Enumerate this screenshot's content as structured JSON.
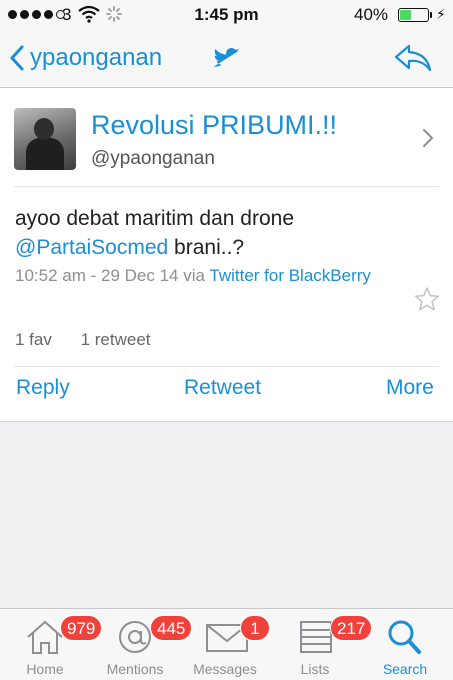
{
  "status_bar": {
    "carrier": "3",
    "time": "1:45 pm",
    "battery_percent": "40%",
    "battery_level": 0.4
  },
  "nav": {
    "back_label": "ypaonganan",
    "center_icon": "twitter-bird-icon",
    "right_icon": "reply-icon"
  },
  "tweet": {
    "display_name": "Revolusi PRIBUMI.!!",
    "handle": "@ypaonganan",
    "text_before": "ayoo debat maritim dan drone",
    "mention": "@PartaiSocmed",
    "text_after": " brani..?",
    "timestamp": "10:52 am - 29 Dec 14",
    "via": "via",
    "client_link": "Twitter for BlackBerry",
    "favs": "1 fav",
    "retweets": "1 retweet"
  },
  "actions": {
    "reply": "Reply",
    "retweet": "Retweet",
    "more": "More"
  },
  "tab_bar": {
    "tabs": [
      {
        "label": "Home",
        "icon": "home-icon",
        "badge": "979"
      },
      {
        "label": "Mentions",
        "icon": "at-icon",
        "badge": "445"
      },
      {
        "label": "Messages",
        "icon": "envelope-icon",
        "badge": "1"
      },
      {
        "label": "Lists",
        "icon": "list-icon",
        "badge": "217"
      },
      {
        "label": "Search",
        "icon": "search-icon",
        "badge": ""
      }
    ],
    "active": "Search"
  },
  "colors": {
    "accent": "#1a8fd6",
    "badge": "#f0413a",
    "battery": "#4cd964"
  }
}
